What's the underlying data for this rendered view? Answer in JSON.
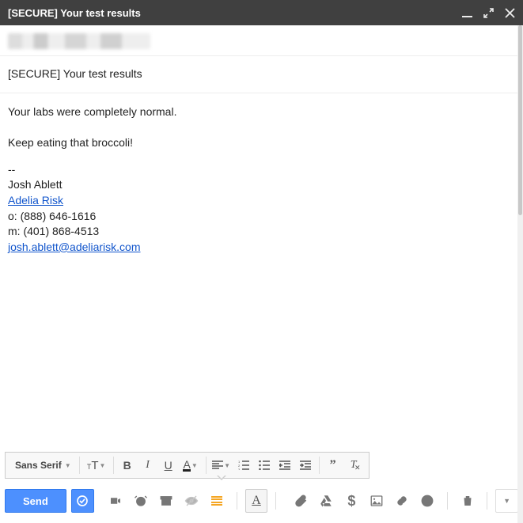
{
  "window": {
    "title": "[SECURE] Your test results"
  },
  "compose": {
    "subject": "[SECURE] Your test results",
    "body_line1": "Your labs were completely normal.",
    "body_line2": "Keep eating that broccoli!",
    "sig_dashes": "--",
    "sig_name": "Josh Ablett",
    "sig_company": "Adelia Risk",
    "sig_office": "o: (888) 646-1616",
    "sig_mobile": "m: (401) 868-4513",
    "sig_email": "josh.ablett@adeliarisk.com"
  },
  "format_toolbar": {
    "font": "Sans Serif"
  },
  "buttons": {
    "send": "Send"
  }
}
